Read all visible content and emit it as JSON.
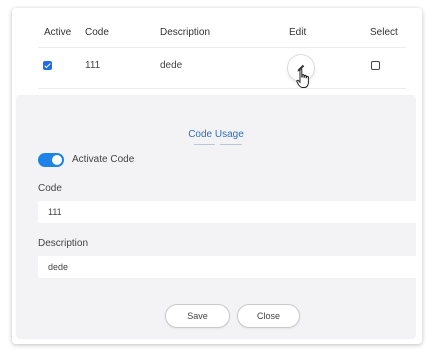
{
  "table": {
    "columns": [
      "Active",
      "Code",
      "Description",
      "Edit",
      "Select"
    ],
    "row": {
      "active": true,
      "code": "111",
      "description": "dede",
      "selected": false
    }
  },
  "icons": {
    "edit": "pencil-icon",
    "cursor": "hand-pointer-cursor",
    "toggle": "toggle-switch"
  },
  "panel": {
    "title": "Code Usage",
    "toggle_label": "Activate Code",
    "toggle_on": true,
    "code_label": "Code",
    "code_value": "111",
    "description_label": "Description",
    "description_value": "dede",
    "save_label": "Save",
    "close_label": "Close"
  },
  "colors": {
    "accent": "#1e82e6",
    "title": "#2f6fb8",
    "panel_bg": "#f3f3f5"
  }
}
